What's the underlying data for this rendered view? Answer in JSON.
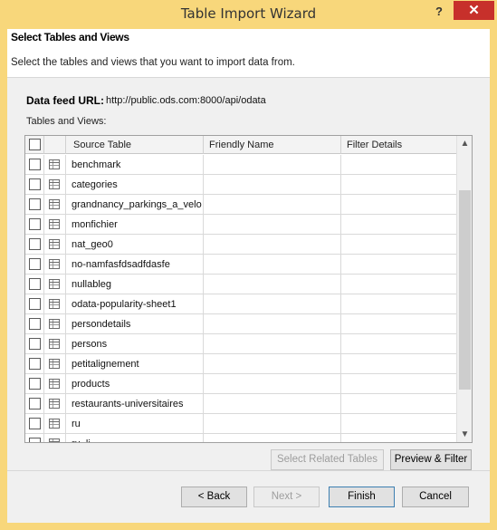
{
  "window": {
    "title": "Table Import Wizard",
    "help_label": "?",
    "close_label": "✕"
  },
  "header": {
    "title": "Select Tables and Views",
    "description": "Select the tables and views that you want to import data from."
  },
  "feed": {
    "label": "Data feed URL:",
    "url": "http://public.ods.com:8000/api/odata"
  },
  "tables_label": "Tables and Views:",
  "grid": {
    "columns": [
      "Source Table",
      "Friendly Name",
      "Filter Details"
    ],
    "rows": [
      {
        "source": "benchmark",
        "friendly": "",
        "filter": "",
        "checked": false
      },
      {
        "source": "categories",
        "friendly": "",
        "filter": "",
        "checked": false
      },
      {
        "source": "grandnancy_parkings_a_velo",
        "friendly": "",
        "filter": "",
        "checked": false
      },
      {
        "source": "monfichier",
        "friendly": "",
        "filter": "",
        "checked": false
      },
      {
        "source": "nat_geo0",
        "friendly": "",
        "filter": "",
        "checked": false
      },
      {
        "source": "no-namfasfdsadfdasfe",
        "friendly": "",
        "filter": "",
        "checked": false
      },
      {
        "source": "nullableg",
        "friendly": "",
        "filter": "",
        "checked": false
      },
      {
        "source": "odata-popularity-sheet1",
        "friendly": "",
        "filter": "",
        "checked": false
      },
      {
        "source": "persondetails",
        "friendly": "",
        "filter": "",
        "checked": false
      },
      {
        "source": "persons",
        "friendly": "",
        "filter": "",
        "checked": false
      },
      {
        "source": "petitalignement",
        "friendly": "",
        "filter": "",
        "checked": false
      },
      {
        "source": "products",
        "friendly": "",
        "filter": "",
        "checked": false
      },
      {
        "source": "restaurants-universitaires",
        "friendly": "",
        "filter": "",
        "checked": false
      },
      {
        "source": "ru",
        "friendly": "",
        "filter": "",
        "checked": false
      },
      {
        "source": "ru_li",
        "friendly": "",
        "filter": "",
        "checked": false
      }
    ]
  },
  "buttons": {
    "select_related": "Select Related Tables",
    "preview_filter": "Preview & Filter",
    "back": "< Back",
    "next": "Next >",
    "finish": "Finish",
    "cancel": "Cancel"
  },
  "colors": {
    "titlebar": "#f8d77b",
    "close": "#c7302b"
  }
}
